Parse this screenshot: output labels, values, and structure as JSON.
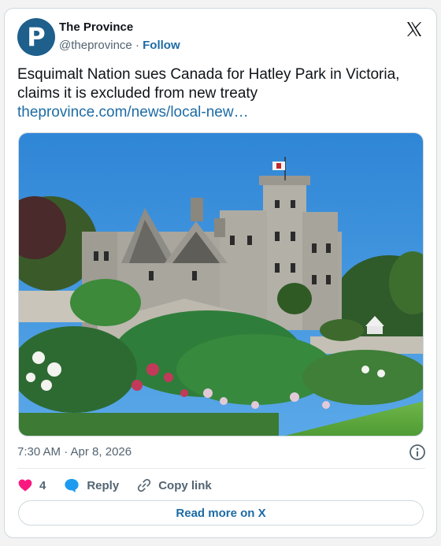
{
  "account": {
    "name": "The Province",
    "handle": "@theprovince",
    "separator": "·",
    "follow_label": "Follow",
    "avatar_letter": "P"
  },
  "tweet": {
    "text": "Esquimalt Nation sues Canada for Hatley Park in Victoria, claims it is excluded from new treaty",
    "link": "theprovince.com/news/local-new…"
  },
  "media": {
    "alt": "Hatley Castle with gardens in Victoria"
  },
  "meta": {
    "timestamp": "7:30 AM · Apr 8, 2026"
  },
  "actions": {
    "like_count": "4",
    "reply_label": "Reply",
    "copy_label": "Copy link"
  },
  "footer": {
    "read_more_label": "Read more on X"
  },
  "colors": {
    "link": "#1d6ba5",
    "like": "#f91880",
    "avatar": "#1e5f8c"
  }
}
